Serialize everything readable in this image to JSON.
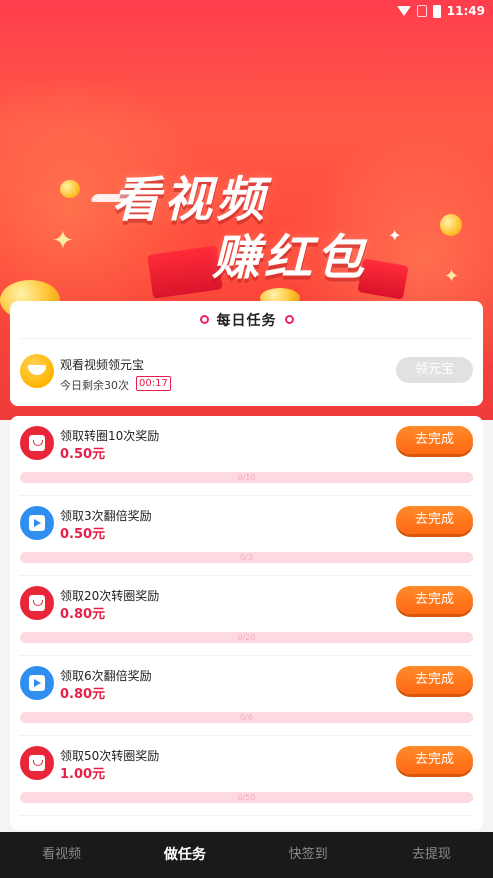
{
  "status_bar": {
    "time": "11:49"
  },
  "hero": {
    "line1": "看视频",
    "line2": "赚红包"
  },
  "daily": {
    "title": "每日任务",
    "task_name": "观看视频领元宝",
    "remaining": "今日剩余30次",
    "timer": "00:17",
    "button_label": "领元宝"
  },
  "tasks": [
    {
      "name": "领取转圈10次奖励",
      "reward": "0.50元",
      "button": "去完成",
      "progress_label": "0/10",
      "progress": 0,
      "icon": "red-packet-icon"
    },
    {
      "name": "领取3次翻倍奖励",
      "reward": "0.50元",
      "button": "去完成",
      "progress_label": "0/3",
      "progress": 0,
      "icon": "video-play-icon"
    },
    {
      "name": "领取20次转圈奖励",
      "reward": "0.80元",
      "button": "去完成",
      "progress_label": "0/20",
      "progress": 0,
      "icon": "red-packet-icon"
    },
    {
      "name": "领取6次翻倍奖励",
      "reward": "0.80元",
      "button": "去完成",
      "progress_label": "0/6",
      "progress": 0,
      "icon": "video-play-icon"
    },
    {
      "name": "领取50次转圈奖励",
      "reward": "1.00元",
      "button": "去完成",
      "progress_label": "0/50",
      "progress": 0,
      "icon": "red-packet-icon"
    }
  ],
  "nav": {
    "items": [
      {
        "label": "看视频"
      },
      {
        "label": "做任务"
      },
      {
        "label": "快签到"
      },
      {
        "label": "去提现"
      }
    ],
    "active_index": 1
  },
  "colors": {
    "accent": "#e5204a",
    "button_orange": "#ff7a1f",
    "hero_red": "#ff3d4d"
  }
}
